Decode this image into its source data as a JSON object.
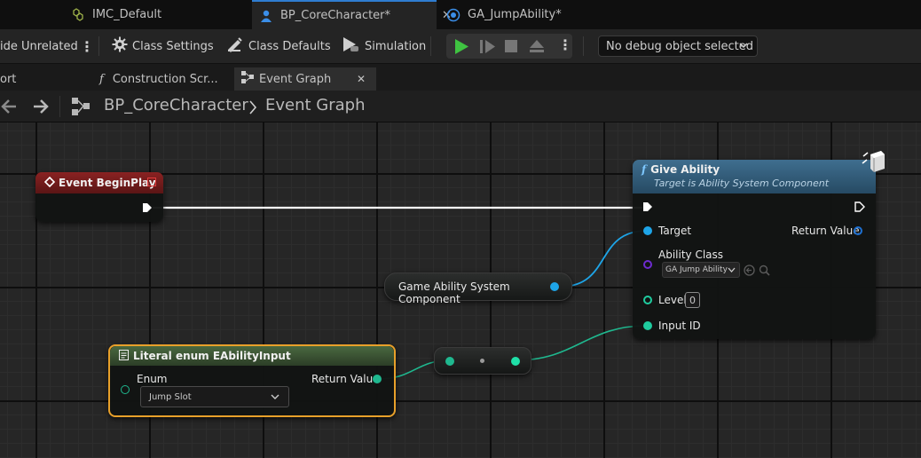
{
  "tabs": [
    {
      "label": "IMC_Default",
      "icon": "input-mapping-icon",
      "color": "#9fb34a"
    },
    {
      "label": "BP_CoreCharacter*",
      "icon": "character-blueprint-icon",
      "color": "#3b8ee8",
      "active": true
    },
    {
      "label": "GA_JumpAbility*",
      "icon": "gameplay-ability-icon",
      "color": "#3b8ee8"
    }
  ],
  "toolbar": {
    "hide_unrelated": "ide Unrelated",
    "class_settings": "Class Settings",
    "class_defaults": "Class Defaults",
    "simulation": "Simulation",
    "debug_object": "No debug object selected"
  },
  "graph_tabs": {
    "viewport": "ort",
    "construction": "Construction Scr...",
    "event_graph": "Event Graph"
  },
  "breadcrumb": {
    "blueprint": "BP_CoreCharacter",
    "graph": "Event Graph"
  },
  "nodes": {
    "event_beginplay": {
      "title": "Event BeginPlay",
      "header_color": "#7a1d1d"
    },
    "give_ability": {
      "title": "Give Ability",
      "subtitle": "Target is Ability System Component",
      "header_color": "#2f5a78",
      "pin_target": "Target",
      "pin_return": "Return Value",
      "pin_ability_class": "Ability Class",
      "ability_class_value": "GA Jump Ability",
      "pin_level": "Level",
      "level_value": "0",
      "pin_input_id": "Input ID"
    },
    "asc_getter": {
      "title": "Game Ability System Component"
    },
    "literal_enum": {
      "title": "Literal enum EAbilityInput",
      "header_color": "#35502f",
      "pin_enum": "Enum",
      "enum_value": "Jump Slot",
      "pin_return": "Return Value"
    }
  },
  "colors": {
    "exec": "#ffffff",
    "object_pin": "#1ea5e8",
    "int_pin": "#1fcc9f",
    "class_pin": "#6d2bd0",
    "selected_outline": "#e8a02a"
  }
}
